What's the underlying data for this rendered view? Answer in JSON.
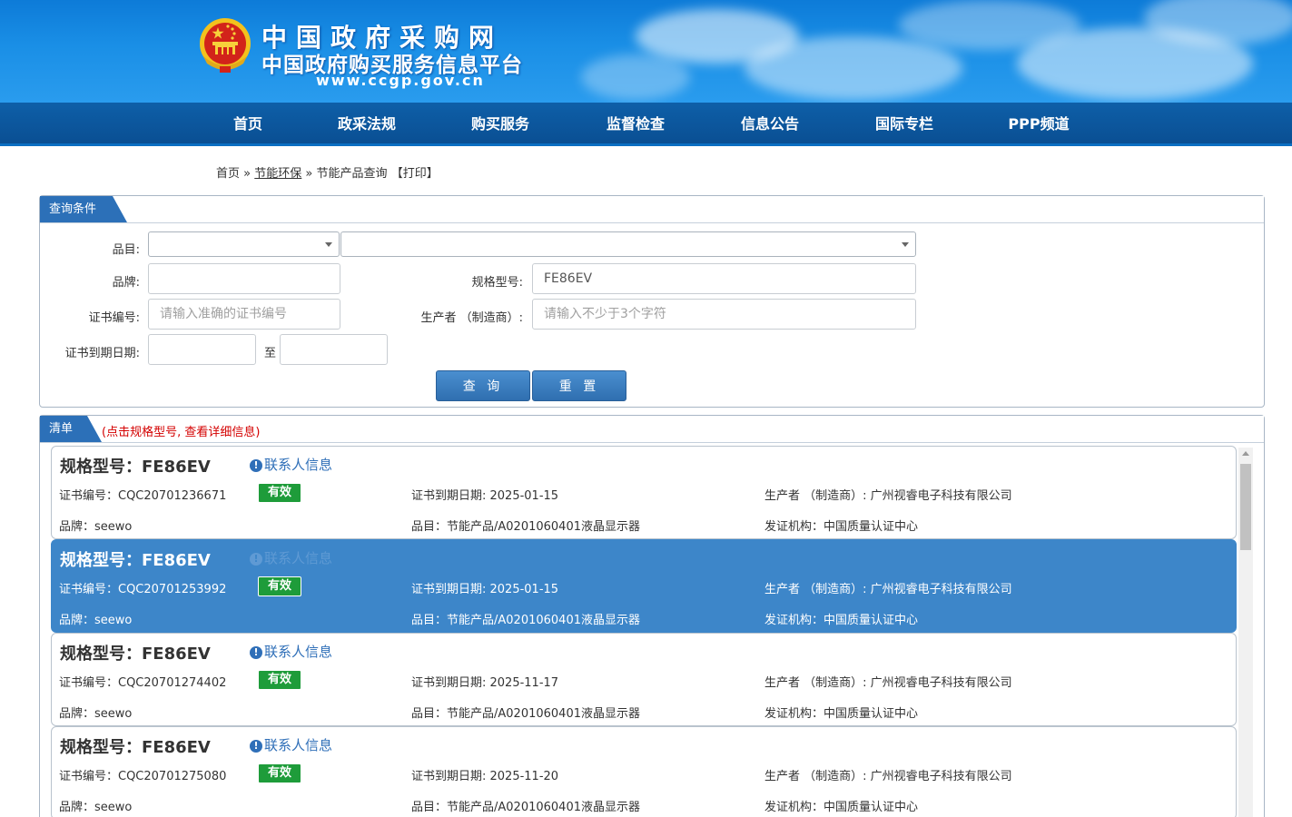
{
  "header": {
    "title_main": "中国政府采购网",
    "title_sub": "中国政府购买服务信息平台",
    "url": "www.ccgp.gov.cn"
  },
  "nav": {
    "items": [
      "首页",
      "政采法规",
      "购买服务",
      "监督检查",
      "信息公告",
      "国际专栏",
      "PPP频道"
    ]
  },
  "breadcrumb": {
    "home": "首页",
    "sep1": "»",
    "section": "节能环保",
    "sep2": "»",
    "current": "节能产品查询",
    "print": "【打印】"
  },
  "query": {
    "tab": "查询条件",
    "category_label": "品目:",
    "brand_label": "品牌:",
    "brand_value": "",
    "spec_label": "规格型号:",
    "spec_value": "FE86EV",
    "cert_label": "证书编号:",
    "cert_placeholder": "请输入准确的证书编号",
    "maker_label": "生产者 （制造商）:",
    "maker_placeholder": "请输入不少于3个字符",
    "expire_label": "证书到期日期:",
    "date_to": "至",
    "search_button": "查 询",
    "reset_button": "重 置"
  },
  "list": {
    "tab": "清单",
    "hint": "(点击规格型号, 查看详细信息)",
    "contact_link": "联系人信息",
    "items": [
      {
        "model": "规格型号：FE86EV",
        "cert": "证书编号：CQC20701236671",
        "status": "有效",
        "expire": "证书到期日期: 2025-01-15",
        "maker": "生产者 （制造商）: 广州视睿电子科技有限公司",
        "brand": "品牌：seewo",
        "category": "品目：节能产品/A0201060401液晶显示器",
        "issuer": "发证机构：中国质量认证中心",
        "selected": false
      },
      {
        "model": "规格型号：FE86EV",
        "cert": "证书编号：CQC20701253992",
        "status": "有效",
        "expire": "证书到期日期: 2025-01-15",
        "maker": "生产者 （制造商）: 广州视睿电子科技有限公司",
        "brand": "品牌：seewo",
        "category": "品目：节能产品/A0201060401液晶显示器",
        "issuer": "发证机构：中国质量认证中心",
        "selected": true
      },
      {
        "model": "规格型号：FE86EV",
        "cert": "证书编号：CQC20701274402",
        "status": "有效",
        "expire": "证书到期日期: 2025-11-17",
        "maker": "生产者 （制造商）: 广州视睿电子科技有限公司",
        "brand": "品牌：seewo",
        "category": "品目：节能产品/A0201060401液晶显示器",
        "issuer": "发证机构：中国质量认证中心",
        "selected": false
      },
      {
        "model": "规格型号：FE86EV",
        "cert": "证书编号：CQC20701275080",
        "status": "有效",
        "expire": "证书到期日期: 2025-11-20",
        "maker": "生产者 （制造商）: 广州视睿电子科技有限公司",
        "brand": "品牌：seewo",
        "category": "品目：节能产品/A0201060401液晶显示器",
        "issuer": "发证机构：中国质量认证中心",
        "selected": false
      }
    ]
  },
  "colors": {
    "nav_bg": "#0a4f93",
    "tab_bg": "#2c70b8",
    "selected_row": "#3d86c9",
    "status_green": "#1e9c3a",
    "hint_red": "#d40000"
  },
  "icons": {
    "emblem": "national-emblem-icon",
    "contact": "info-circle-icon",
    "select_caret": "chevron-down-icon"
  }
}
